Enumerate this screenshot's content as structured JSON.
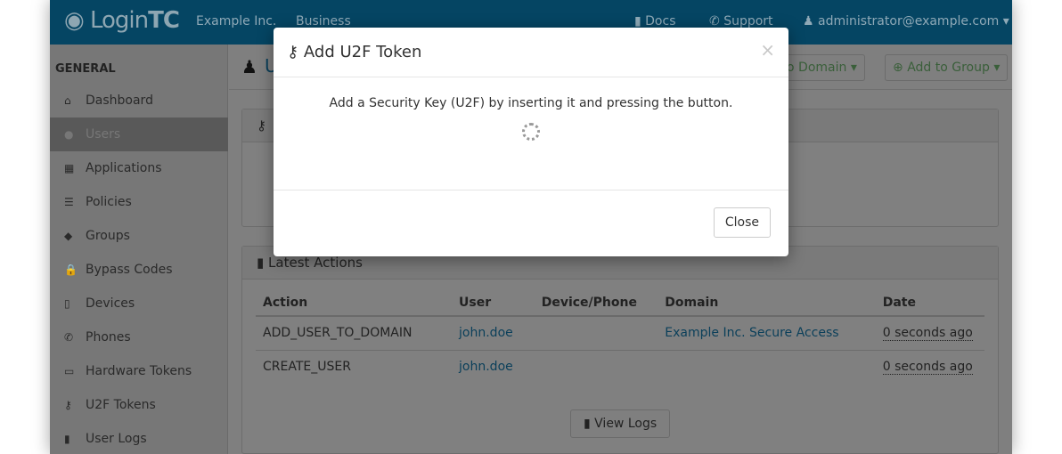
{
  "nav": {
    "logo": "LoginTC",
    "org": "Example Inc.",
    "plan": "Business",
    "docs": "Docs",
    "support": "Support",
    "user": "administrator@example.com"
  },
  "sidebar": {
    "section": "GENERAL",
    "items": [
      {
        "label": "Dashboard",
        "icon": "home-icon",
        "glyph": "⌂"
      },
      {
        "label": "Users",
        "icon": "user-icon",
        "glyph": "●",
        "active": true
      },
      {
        "label": "Applications",
        "icon": "grid-icon",
        "glyph": "▦"
      },
      {
        "label": "Policies",
        "icon": "list-icon",
        "glyph": "☰"
      },
      {
        "label": "Groups",
        "icon": "group-icon",
        "glyph": "◆"
      },
      {
        "label": "Bypass Codes",
        "icon": "lock-icon",
        "glyph": "🔒"
      },
      {
        "label": "Devices",
        "icon": "mobile-icon",
        "glyph": "▯"
      },
      {
        "label": "Phones",
        "icon": "phone-icon",
        "glyph": "✆"
      },
      {
        "label": "Hardware Tokens",
        "icon": "hdd-icon",
        "glyph": "▭"
      },
      {
        "label": "U2F Tokens",
        "icon": "key-icon",
        "glyph": "⚷"
      },
      {
        "label": "User Logs",
        "icon": "book-icon",
        "glyph": "▮"
      }
    ]
  },
  "page": {
    "title": "Users",
    "add_domain": "Add to Domain",
    "add_group": "Add to Group"
  },
  "latest": {
    "title": "Latest Actions",
    "columns": [
      "Action",
      "User",
      "Device/Phone",
      "Domain",
      "Date"
    ],
    "rows": [
      [
        "ADD_USER_TO_DOMAIN",
        "john.doe",
        "",
        "Example Inc. Secure Access",
        "0 seconds ago"
      ],
      [
        "CREATE_USER",
        "john.doe",
        "",
        "",
        "0 seconds ago"
      ]
    ],
    "view_logs": "View Logs"
  },
  "modal": {
    "title": "Add U2F Token",
    "message": "Add a Security Key (U2F) by inserting it and pressing the button.",
    "close": "Close",
    "close_x": "×"
  }
}
